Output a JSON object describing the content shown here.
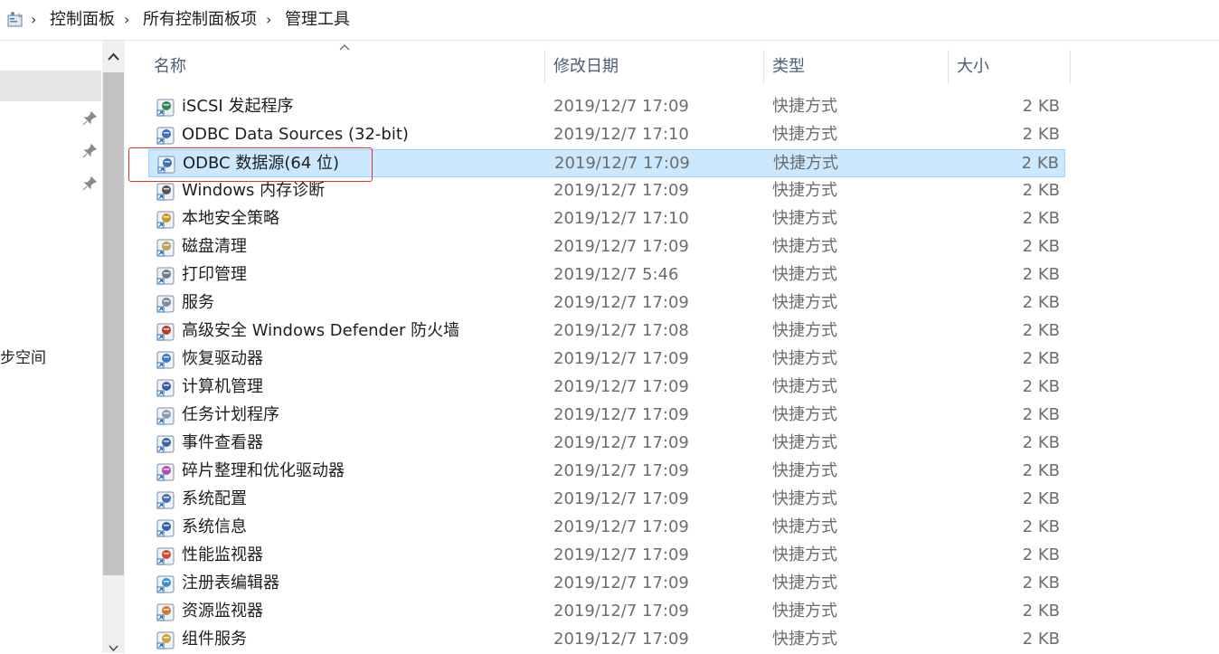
{
  "breadcrumb": [
    "控制面板",
    "所有控制面板项",
    "管理工具"
  ],
  "nav": {
    "partial_item": "步空间"
  },
  "columns": {
    "name": "名称",
    "date": "修改日期",
    "type": "类型",
    "size": "大小"
  },
  "files": [
    {
      "name": "iSCSI 发起程序",
      "date": "2019/12/7 17:09",
      "type": "快捷方式",
      "size": "2 KB",
      "icon": "iscsi-icon"
    },
    {
      "name": "ODBC Data Sources (32-bit)",
      "date": "2019/12/7 17:10",
      "type": "快捷方式",
      "size": "2 KB",
      "icon": "odbc-icon"
    },
    {
      "name": "ODBC 数据源(64 位)",
      "date": "2019/12/7 17:09",
      "type": "快捷方式",
      "size": "2 KB",
      "icon": "odbc-icon",
      "selected": true
    },
    {
      "name": "Windows 内存诊断",
      "date": "2019/12/7 17:09",
      "type": "快捷方式",
      "size": "2 KB",
      "icon": "memory-diagnostic-icon"
    },
    {
      "name": "本地安全策略",
      "date": "2019/12/7 17:10",
      "type": "快捷方式",
      "size": "2 KB",
      "icon": "security-policy-icon"
    },
    {
      "name": "磁盘清理",
      "date": "2019/12/7 17:09",
      "type": "快捷方式",
      "size": "2 KB",
      "icon": "disk-cleanup-icon"
    },
    {
      "name": "打印管理",
      "date": "2019/12/7 5:46",
      "type": "快捷方式",
      "size": "2 KB",
      "icon": "print-management-icon"
    },
    {
      "name": "服务",
      "date": "2019/12/7 17:09",
      "type": "快捷方式",
      "size": "2 KB",
      "icon": "services-icon"
    },
    {
      "name": "高级安全 Windows Defender 防火墙",
      "date": "2019/12/7 17:08",
      "type": "快捷方式",
      "size": "2 KB",
      "icon": "firewall-icon"
    },
    {
      "name": "恢复驱动器",
      "date": "2019/12/7 17:09",
      "type": "快捷方式",
      "size": "2 KB",
      "icon": "recovery-drive-icon"
    },
    {
      "name": "计算机管理",
      "date": "2019/12/7 17:09",
      "type": "快捷方式",
      "size": "2 KB",
      "icon": "computer-management-icon"
    },
    {
      "name": "任务计划程序",
      "date": "2019/12/7 17:09",
      "type": "快捷方式",
      "size": "2 KB",
      "icon": "task-scheduler-icon"
    },
    {
      "name": "事件查看器",
      "date": "2019/12/7 17:09",
      "type": "快捷方式",
      "size": "2 KB",
      "icon": "event-viewer-icon"
    },
    {
      "name": "碎片整理和优化驱动器",
      "date": "2019/12/7 17:09",
      "type": "快捷方式",
      "size": "2 KB",
      "icon": "defrag-icon"
    },
    {
      "name": "系统配置",
      "date": "2019/12/7 17:09",
      "type": "快捷方式",
      "size": "2 KB",
      "icon": "system-config-icon"
    },
    {
      "name": "系统信息",
      "date": "2019/12/7 17:09",
      "type": "快捷方式",
      "size": "2 KB",
      "icon": "system-info-icon"
    },
    {
      "name": "性能监视器",
      "date": "2019/12/7 17:09",
      "type": "快捷方式",
      "size": "2 KB",
      "icon": "performance-monitor-icon"
    },
    {
      "name": "注册表编辑器",
      "date": "2019/12/7 17:09",
      "type": "快捷方式",
      "size": "2 KB",
      "icon": "registry-editor-icon"
    },
    {
      "name": "资源监视器",
      "date": "2019/12/7 17:09",
      "type": "快捷方式",
      "size": "2 KB",
      "icon": "resource-monitor-icon"
    },
    {
      "name": "组件服务",
      "date": "2019/12/7 17:09",
      "type": "快捷方式",
      "size": "2 KB",
      "icon": "component-services-icon"
    }
  ],
  "colors": {
    "selection_bg": "#cce8ff",
    "selection_border": "#99d1ff",
    "highlight_box": "#e0302a",
    "header_text": "#4c607a"
  }
}
